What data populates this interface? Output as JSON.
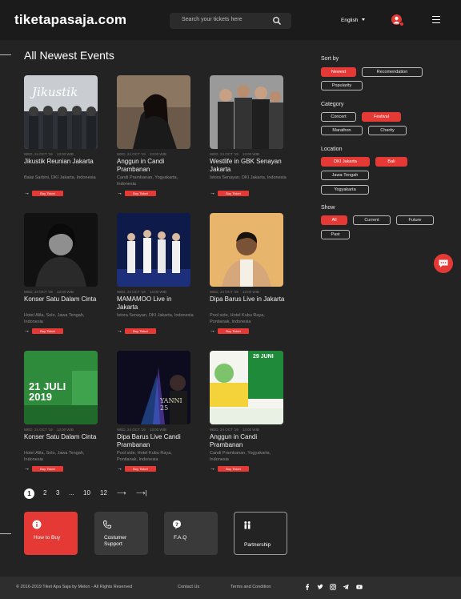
{
  "header": {
    "logo": "tiketapasaja.com",
    "search_placeholder": "Search your tickets here",
    "language": "English"
  },
  "section_title": "All Newest Events",
  "events": [
    {
      "date": "WED, 24 OCT '19",
      "time": "13:00 WIB",
      "title": "Jikustik Reunian Jakarta",
      "venue": "Balai Sarbini, DKI Jakarta, Indonesia",
      "button": "Buy Ticket",
      "image_text": "Jikustik"
    },
    {
      "date": "WED, 24 OCT '19",
      "time": "13:00 WIB",
      "title": "Anggun in Candi Prambanan",
      "venue": "Candi Prambanan, Yogyakarta, Indonesia",
      "button": "Buy Ticket",
      "image_text": ""
    },
    {
      "date": "WED, 24 OCT '19",
      "time": "13:00 WIB",
      "title": "Westlife in GBK Senayan Jakarta",
      "venue": "Istora Senayan, DKI Jakarta, Indonesia",
      "button": "Buy Ticket",
      "image_text": ""
    },
    {
      "date": "WED, 24 OCT '19",
      "time": "13:00 WIB",
      "title": "Konser Satu Dalam Cinta",
      "venue": "Hotel Alila, Solo, Jawa Tengah, Indonesia",
      "button": "Buy Ticket",
      "image_text": ""
    },
    {
      "date": "WED, 24 OCT '19",
      "time": "13:00 WIB",
      "title": "MAMAMOO Live in Jakarta",
      "venue": "Istora Senayan, DKI Jakarta, Indonesia",
      "button": "Buy Ticket",
      "image_text": ""
    },
    {
      "date": "WED, 24 OCT '19",
      "time": "13:00 WIB",
      "title": "Dipa Barus Live in Jakarta",
      "venue": "Pool side, Hotel Kubu Raya, Pontianak, Indonesia",
      "button": "Buy Ticket",
      "image_text": ""
    },
    {
      "date": "WED, 24 OCT '19",
      "time": "13:00 WIB",
      "title": "Konser Satu Dalam Cinta",
      "venue": "Hotel Alila, Solo, Jawa Tengah, Indonesia",
      "button": "Buy Ticket",
      "image_text": "21 JULI 2019"
    },
    {
      "date": "WED, 24 OCT '19",
      "time": "13:00 WIB",
      "title": "Dipa Barus Live Candi Prambanan",
      "venue": "Pool side, Hotel Kubu Raya, Pontianak, Indonesia",
      "button": "Buy Ticket",
      "image_text": "YANNI 25"
    },
    {
      "date": "WED, 24 OCT '19",
      "time": "13:00 WIB",
      "title": "Anggun in Candi Prambanan",
      "venue": "Candi Prambanan, Yogyakarta, Indonesia",
      "button": "Buy Ticket",
      "image_text": "29 JUNI"
    }
  ],
  "pagination": {
    "pages": [
      "1",
      "2",
      "3",
      "...",
      "10",
      "12"
    ],
    "next": "⟶",
    "last": "⟶|"
  },
  "tiles": [
    {
      "label": "How to Buy",
      "icon": "info-icon"
    },
    {
      "label": "Costumer Support",
      "icon": "phone-icon"
    },
    {
      "label": "F.A.Q",
      "icon": "question-icon"
    },
    {
      "label": "Partnership",
      "icon": "people-icon"
    }
  ],
  "filters": {
    "sort_title": "Sort by",
    "sort": [
      "Newest",
      "Recomendation",
      "Popularity"
    ],
    "category_title": "Category",
    "category": [
      "Concert",
      "Festival",
      "Marathon",
      "Charity"
    ],
    "location_title": "Location",
    "location": [
      "DKI Jakarta",
      "Bali",
      "Jawa-Tengah",
      "Yogyakarta"
    ],
    "show_title": "Show",
    "show": [
      "All",
      "Current",
      "Future",
      "Past"
    ]
  },
  "footer": {
    "copyright": "© 2016-2019 Tiket Apa Saja by Melon - All Rights Reserved",
    "contact": "Contact Us",
    "terms": "Terms and Condition"
  },
  "colors": {
    "accent": "#e53935",
    "background": "#232323"
  }
}
